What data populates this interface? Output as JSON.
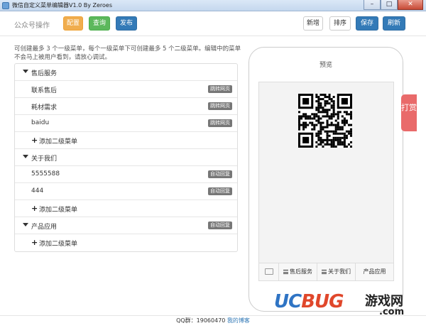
{
  "window": {
    "title": "微信自定义菜单编辑器V1.0 By Zeroes",
    "minimize": "–",
    "maximize": "□",
    "close": "✕"
  },
  "toolbar": {
    "brand": "公众号操作",
    "config": "配置",
    "query": "查询",
    "publish": "发布",
    "add": "新增",
    "sort": "排序",
    "save": "保存",
    "refresh": "刷新"
  },
  "intro": "可创建最多 3 个一级菜单，每个一级菜单下可创建最多 5 个二级菜单。编辑中的菜单不会马上被用户看到，请放心调试。",
  "menu": {
    "add_sub_label": "添加二级菜单",
    "groups": [
      {
        "name": "售后服务",
        "children": [
          {
            "name": "联系售后",
            "tag": "跳转网页"
          },
          {
            "name": "耗材需求",
            "tag": "跳转网页"
          },
          {
            "name": "baidu",
            "tag": "跳转网页"
          }
        ]
      },
      {
        "name": "关于我们",
        "children": [
          {
            "name": "5555588",
            "tag": "自动回复"
          },
          {
            "name": "444",
            "tag": "自动回复"
          }
        ]
      },
      {
        "name": "产品应用",
        "tag": "自动回复",
        "children": []
      }
    ]
  },
  "preview": {
    "title": "预览",
    "menubar": [
      "售后服务",
      "关于我们",
      "产品应用"
    ]
  },
  "reward": "打赏",
  "footer": {
    "qq": "QQ群：19060470",
    "blog": "我的博客"
  },
  "watermark": {
    "logo_uc": "UC",
    "logo_bug": "BUG",
    "cn": "游戏网",
    "domain": ".com"
  },
  "colors": {
    "orange": "#f0ad4e",
    "green": "#5cb85c",
    "blue": "#337ab7",
    "tag": "#777777",
    "reward": "#e96a6a"
  }
}
